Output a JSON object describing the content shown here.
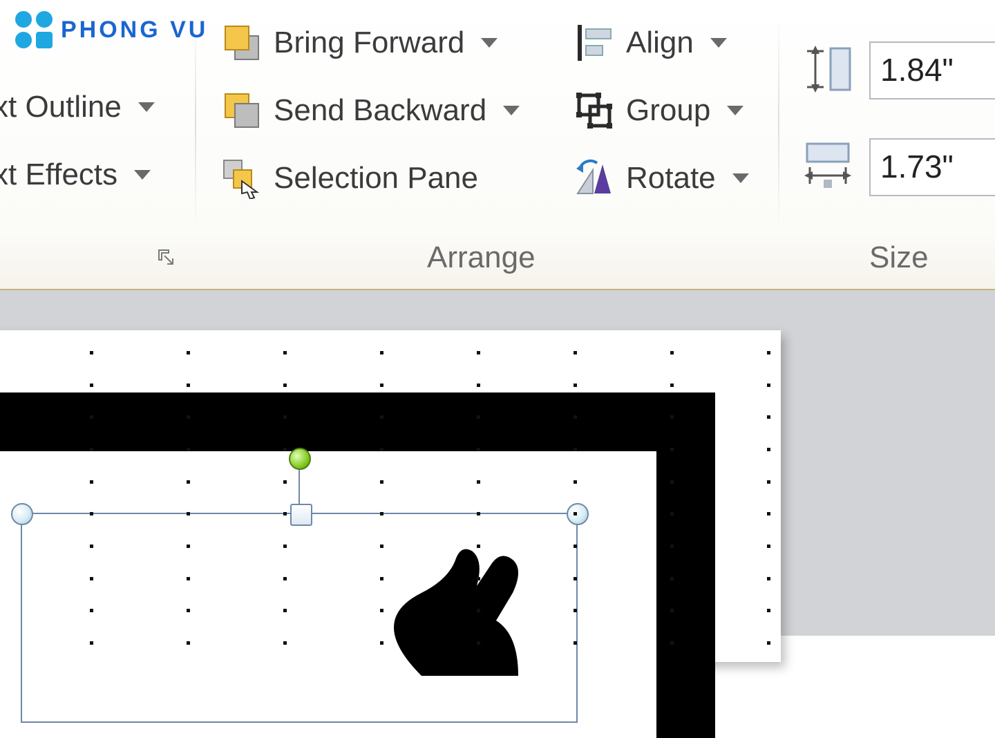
{
  "watermark": {
    "text": "PHONG VU"
  },
  "wordart_group": {
    "label": "",
    "buttons": {
      "text_outline": "xt Outline",
      "text_effects": "xt Effects"
    }
  },
  "arrange_group": {
    "label": "Arrange",
    "buttons": {
      "bring_forward": "Bring Forward",
      "send_backward": "Send Backward",
      "selection_pane": "Selection Pane",
      "align": "Align",
      "group": "Group",
      "rotate": "Rotate"
    }
  },
  "size_group": {
    "label": "Size",
    "height": "1.84\"",
    "width": "1.73\""
  }
}
